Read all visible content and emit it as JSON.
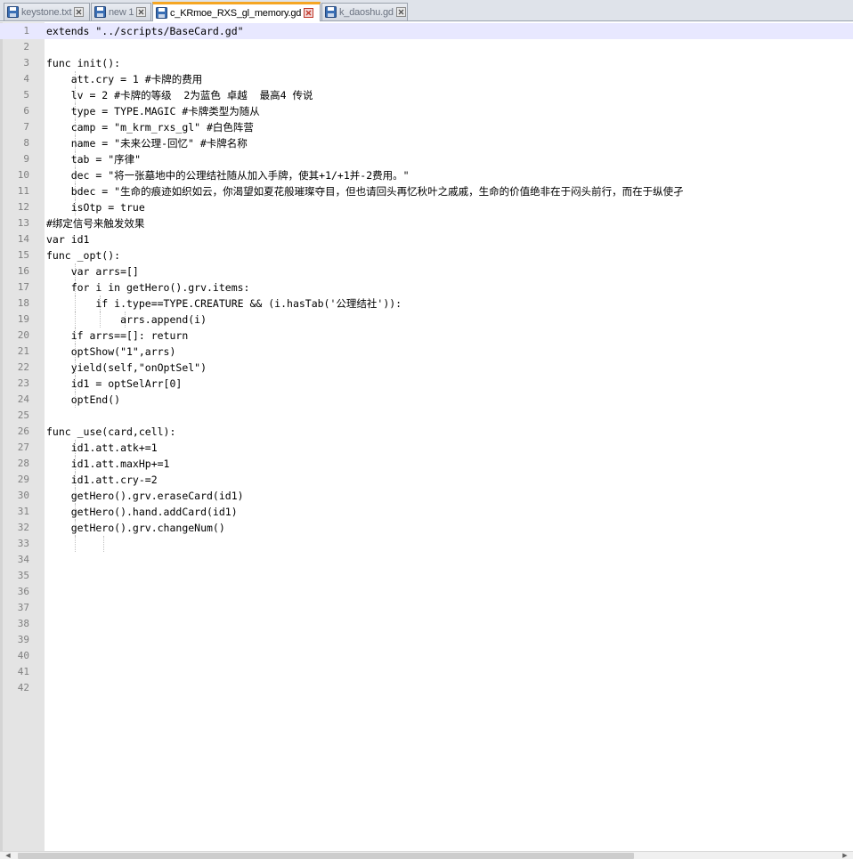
{
  "tabs": [
    {
      "label": "keystone.txt",
      "active": false
    },
    {
      "label": "new 1",
      "active": false
    },
    {
      "label": "c_KRmoe_RXS_gl_memory.gd",
      "active": true
    },
    {
      "label": "k_daoshu.gd",
      "active": false
    }
  ],
  "colors": {
    "accent_tab": "#f5a623",
    "save_icon": "#3a6fb5",
    "close_icon": "#d9534f",
    "current_line": "#e8e8ff",
    "gutter": "#e4e4e4"
  },
  "editor": {
    "lines": [
      {
        "n": "1",
        "text": "extends \"../scripts/BaseCard.gd\""
      },
      {
        "n": "2",
        "text": ""
      },
      {
        "n": "3",
        "text": "func init():"
      },
      {
        "n": "4",
        "text": "    att.cry = 1 #卡牌的费用"
      },
      {
        "n": "5",
        "text": "    lv = 2 #卡牌的等级  2为蓝色 卓越  最高4 传说"
      },
      {
        "n": "6",
        "text": "    type = TYPE.MAGIC #卡牌类型为随从"
      },
      {
        "n": "7",
        "text": "    camp = \"m_krm_rxs_gl\" #白色阵营"
      },
      {
        "n": "8",
        "text": "    name = \"未来公理-回忆\" #卡牌名称"
      },
      {
        "n": "9",
        "text": "    tab = \"序律\""
      },
      {
        "n": "10",
        "text": "    dec = \"将一张墓地中的公理结社随从加入手牌，使其+1/+1并-2费用。\""
      },
      {
        "n": "11",
        "text": "    bdec = \"生命的痕迹如织如云，你渴望如夏花般璀璨夺目，但也请回头再忆秋叶之戚戚，生命的价值绝非在于闷头前行，而在于纵使孑"
      },
      {
        "n": "12",
        "text": "    isOtp = true"
      },
      {
        "n": "13",
        "text": "#绑定信号来触发效果"
      },
      {
        "n": "14",
        "text": "var id1"
      },
      {
        "n": "15",
        "text": "func _opt():"
      },
      {
        "n": "16",
        "text": "    var arrs=[]"
      },
      {
        "n": "17",
        "text": "    for i in getHero().grv.items:"
      },
      {
        "n": "18",
        "text": "        if i.type==TYPE.CREATURE && (i.hasTab('公理结社')):"
      },
      {
        "n": "19",
        "text": "            arrs.append(i)"
      },
      {
        "n": "20",
        "text": "    if arrs==[]: return"
      },
      {
        "n": "21",
        "text": "    optShow(\"1\",arrs)"
      },
      {
        "n": "22",
        "text": "    yield(self,\"onOptSel\")"
      },
      {
        "n": "23",
        "text": "    id1 = optSelArr[0]"
      },
      {
        "n": "24",
        "text": "    optEnd()"
      },
      {
        "n": "25",
        "text": ""
      },
      {
        "n": "26",
        "text": "func _use(card,cell):"
      },
      {
        "n": "27",
        "text": "    id1.att.atk+=1"
      },
      {
        "n": "28",
        "text": "    id1.att.maxHp+=1"
      },
      {
        "n": "29",
        "text": "    id1.att.cry-=2"
      },
      {
        "n": "30",
        "text": "    getHero().grv.eraseCard(id1)"
      },
      {
        "n": "31",
        "text": "    getHero().hand.addCard(id1)"
      },
      {
        "n": "32",
        "text": "    getHero().grv.changeNum()"
      },
      {
        "n": "33",
        "text": ""
      },
      {
        "n": "34",
        "text": ""
      },
      {
        "n": "35",
        "text": ""
      },
      {
        "n": "36",
        "text": ""
      },
      {
        "n": "37",
        "text": ""
      },
      {
        "n": "38",
        "text": ""
      },
      {
        "n": "39",
        "text": ""
      },
      {
        "n": "40",
        "text": ""
      },
      {
        "n": "41",
        "text": ""
      },
      {
        "n": "42",
        "text": ""
      }
    ]
  },
  "scrollbar": {
    "left_arrow": "◀",
    "right_arrow": "▶"
  }
}
